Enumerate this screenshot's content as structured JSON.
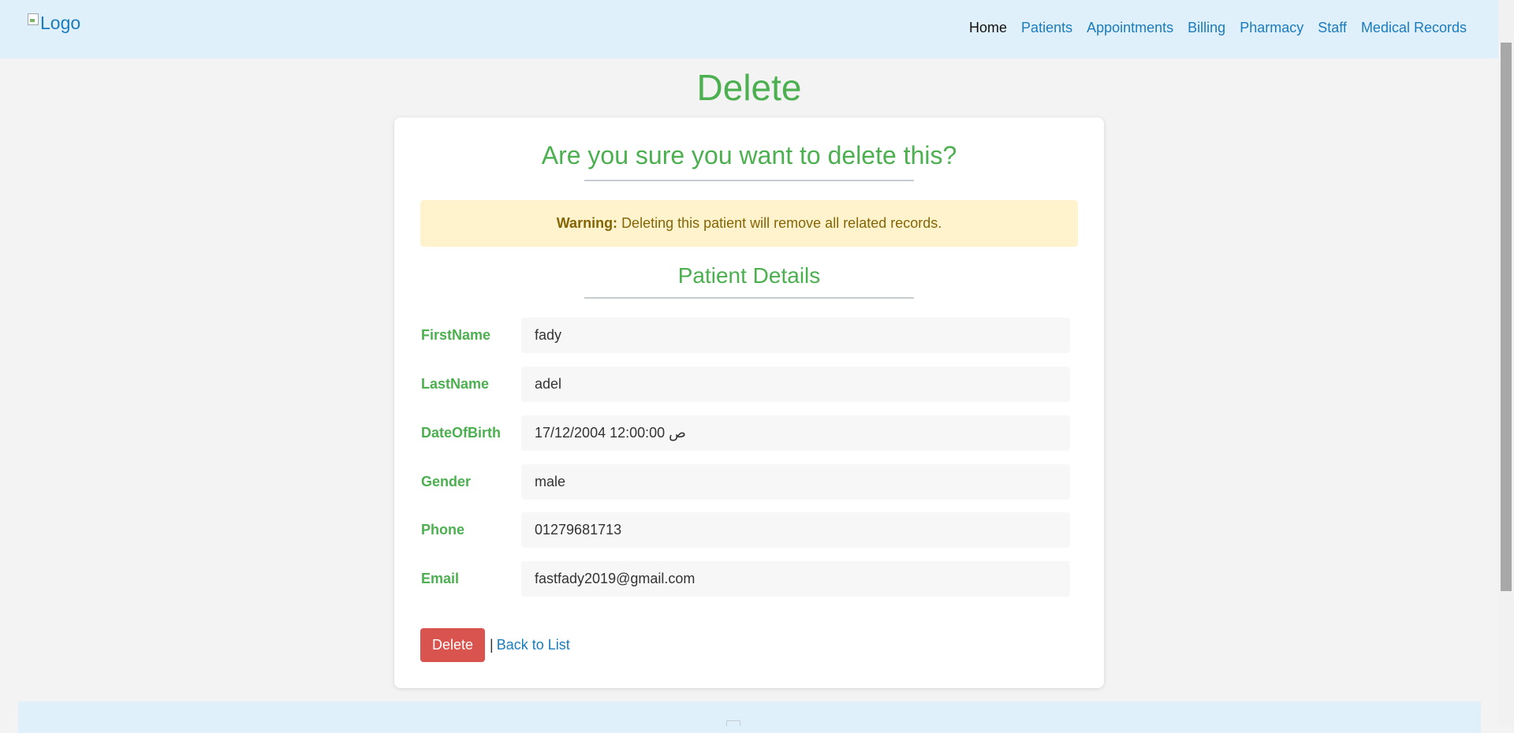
{
  "header": {
    "logo_alt": "Logo",
    "nav": [
      {
        "label": "Home",
        "active": true
      },
      {
        "label": "Patients",
        "active": false
      },
      {
        "label": "Appointments",
        "active": false
      },
      {
        "label": "Billing",
        "active": false
      },
      {
        "label": "Pharmacy",
        "active": false
      },
      {
        "label": "Staff",
        "active": false
      },
      {
        "label": "Medical Records",
        "active": false
      }
    ]
  },
  "page": {
    "title": "Delete",
    "question": "Are you sure you want to delete this?",
    "warning_label": "Warning:",
    "warning_text": "Deleting this patient will remove all related records.",
    "section_title": "Patient Details"
  },
  "patient": [
    {
      "label": "FirstName",
      "value": "fady"
    },
    {
      "label": "LastName",
      "value": "adel"
    },
    {
      "label": "DateOfBirth",
      "value": "17/12/2004 12:00:00 ص"
    },
    {
      "label": "Gender",
      "value": "male"
    },
    {
      "label": "Phone",
      "value": "01279681713"
    },
    {
      "label": "Email",
      "value": "fastfady2019@gmail.com"
    }
  ],
  "actions": {
    "delete_label": "Delete",
    "separator": "|",
    "back_label": "Back to List"
  },
  "colors": {
    "accent_green": "#4caf50",
    "link_blue": "#1a7bbd",
    "danger_red": "#d9534f",
    "warning_bg": "#fff3cd",
    "header_bg": "#e0f0fb"
  }
}
